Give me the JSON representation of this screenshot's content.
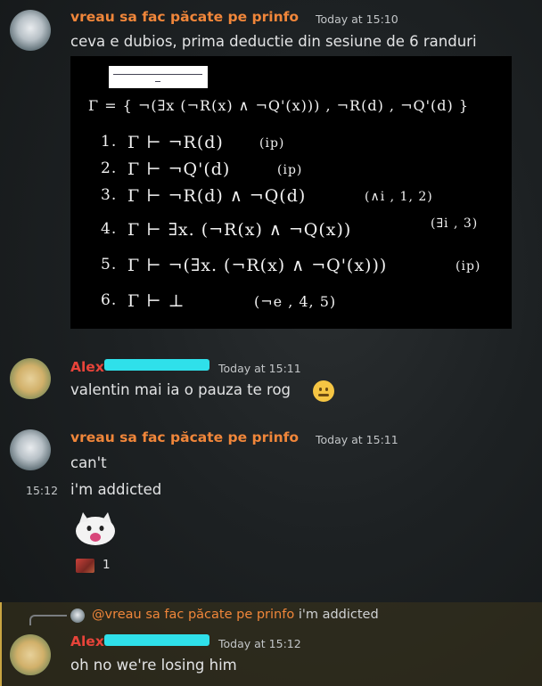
{
  "messages": [
    {
      "author": "vreau sa fac păcate pe prinfo",
      "author_color": "#f0863a",
      "time": "Today at 15:10",
      "text": "ceva e dubios, prima deductie din sesiune de 6 randuri"
    },
    {
      "author": "Alex",
      "author_color": "#e8443a",
      "time": "Today at 15:11",
      "text": "valentin mai ia o pauza te rog"
    },
    {
      "author": "vreau sa fac păcate pe prinfo",
      "author_color": "#f0863a",
      "time": "Today at 15:11",
      "text": "can't",
      "followup_time": "15:12",
      "followup_text": "i'm addicted",
      "reaction_count": "1"
    },
    {
      "author": "Alex",
      "author_color": "#e8443a",
      "time": "Today at 15:12",
      "text": "oh no we're losing him",
      "reply_mention": "@vreau sa fac păcate pe prinfo",
      "reply_text": "i'm addicted"
    }
  ],
  "proof": {
    "gamma": "Γ = { ¬(∃x (¬R(x) ∧ ¬Q'(x))) , ¬R(d) , ¬Q'(d) }",
    "lines": [
      {
        "n": "1.",
        "f": "Γ ⊢  ¬R(d)",
        "r": "(ip)"
      },
      {
        "n": "2.",
        "f": "Γ ⊢  ¬Q'(d)",
        "r": "(ip)"
      },
      {
        "n": "3.",
        "f": "Γ ⊢  ¬R(d) ∧ ¬Q(d)",
        "r": "(∧i , 1, 2)"
      },
      {
        "n": "4.",
        "f": "Γ ⊢  ∃x. (¬R(x) ∧ ¬Q(x))",
        "r": "(∃i , 3)"
      },
      {
        "n": "5.",
        "f": "Γ ⊢  ¬(∃x. (¬R(x) ∧ ¬Q'(x)))",
        "r": "(ip)"
      },
      {
        "n": "6.",
        "f": "Γ ⊢   ⊥",
        "r": "(¬e , 4, 5)"
      }
    ]
  }
}
